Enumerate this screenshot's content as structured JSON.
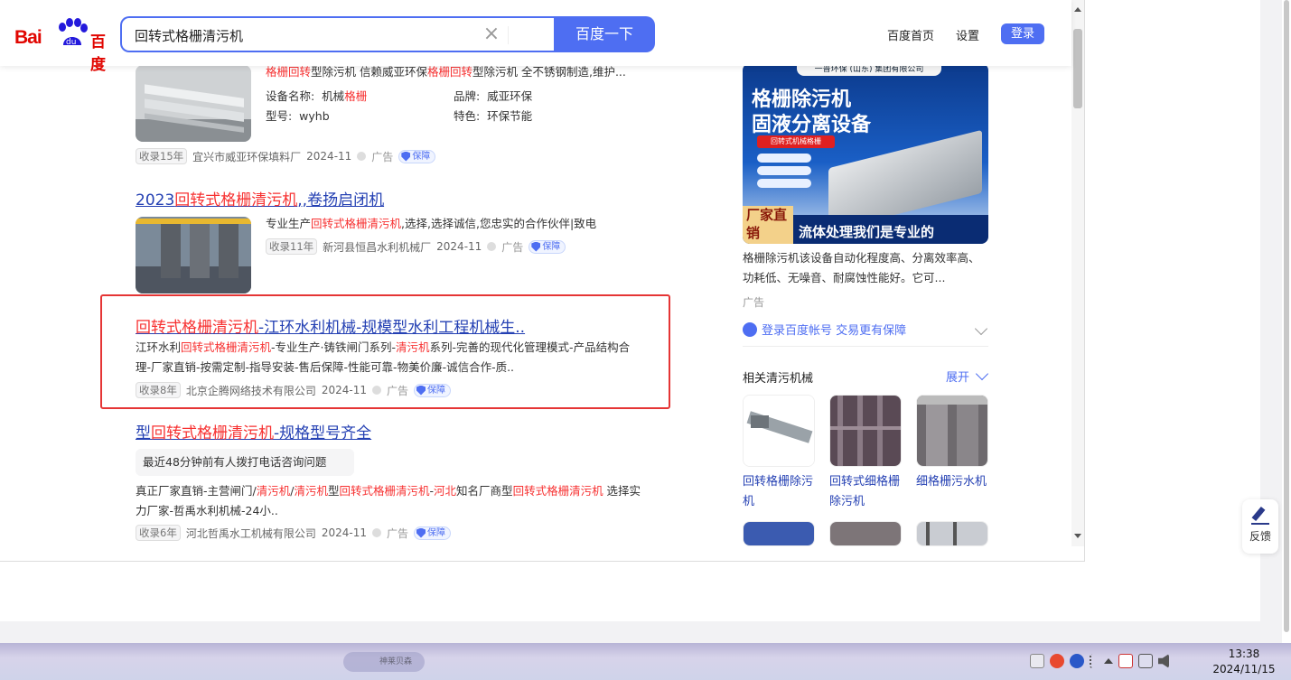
{
  "header": {
    "logo_left": "Bai",
    "logo_right": "百度",
    "search_value": "回转式格栅清污机",
    "search_button": "百度一下",
    "nav_home": "百度首页",
    "nav_settings": "设置",
    "login": "登录"
  },
  "results": [
    {
      "desc_parts": [
        "格栅回转",
        "型除污机 信赖威亚环保",
        "格栅回转",
        "型除污机 全不锈钢制造,维护..."
      ],
      "specs": {
        "k1": "设备名称:",
        "v1a": "机械",
        "v1b": "格栅",
        "k2": "品牌:",
        "v2": "威亚环保",
        "k3": "型号:",
        "v3": "wyhb",
        "k4": "特色:",
        "v4": "环保节能"
      },
      "tag": "收录15年",
      "company": "宜兴市威亚环保填料厂",
      "date": "2024-11",
      "ad": "广告",
      "guard": "保障"
    },
    {
      "title_parts": [
        "2023",
        "回转式格栅清污机",
        ",,卷扬启闭机"
      ],
      "desc_parts": [
        "专业生产",
        "回转式格栅清污机",
        ",选择,选择诚信,您忠实的合作伙伴|致电"
      ],
      "tag": "收录11年",
      "company": "新河县恒昌水利机械厂",
      "date": "2024-11",
      "ad": "广告",
      "guard": "保障"
    },
    {
      "title_parts": [
        "回转式格栅清污机",
        "-江环水利机械-规模型水利工程机械生.."
      ],
      "desc_parts": [
        "江环水利",
        "回转式格栅清污机",
        "-专业生产·铸铁闸门系列-",
        "清污机",
        "系列-完善的现代化管理模式-产品结构合理-厂家直销-按需定制-指导安装-售后保障-性能可靠-物美价廉-诚信合作-质.."
      ],
      "tag": "收录8年",
      "company": "北京企腾网络技术有限公司",
      "date": "2024-11",
      "ad": "广告",
      "guard": "保障"
    },
    {
      "title_parts": [
        "型",
        "回转式格栅清污机",
        "-规格型号齐全"
      ],
      "call": "最近48分钟前有人拨打电话咨询问题",
      "desc_parts": [
        "真正厂家直销-主营闸门/",
        "清污机",
        "/",
        "清污机",
        "型",
        "回转式格栅清污机",
        "-",
        "河北",
        "知名厂商型",
        "回转式格栅清污机",
        " 选择实力厂家-哲禹水利机械-24小.."
      ],
      "tag": "收录6年",
      "company": "河北哲禹水工机械有限公司",
      "date": "2024-11",
      "ad": "广告",
      "guard": "保障"
    }
  ],
  "right_ad": {
    "img_top": "一普环保 (山东) 集团有限公司",
    "img_line1": "格栅除污机",
    "img_line2": "固液分离设备",
    "img_tag": "回转式机械格栅",
    "img_factory": "厂家直销",
    "img_slogan": "流体处理我们是专业的",
    "text": "格栅除污机该设备自动化程度高、分离效率高、功耗低、无噪音、耐腐蚀性能好。它可...",
    "ad_label": "广告",
    "login_guard": "登录百度帐号 交易更有保障"
  },
  "related": {
    "title": "相关清污机械",
    "expand": "展开",
    "items": [
      "回转格栅除污机",
      "回转式细格栅除污机",
      "细格栅污水机"
    ]
  },
  "feedback": "反馈",
  "taskbar": {
    "time": "13:38",
    "date": "2024/11/15",
    "blur_label": "神莱贝森"
  }
}
